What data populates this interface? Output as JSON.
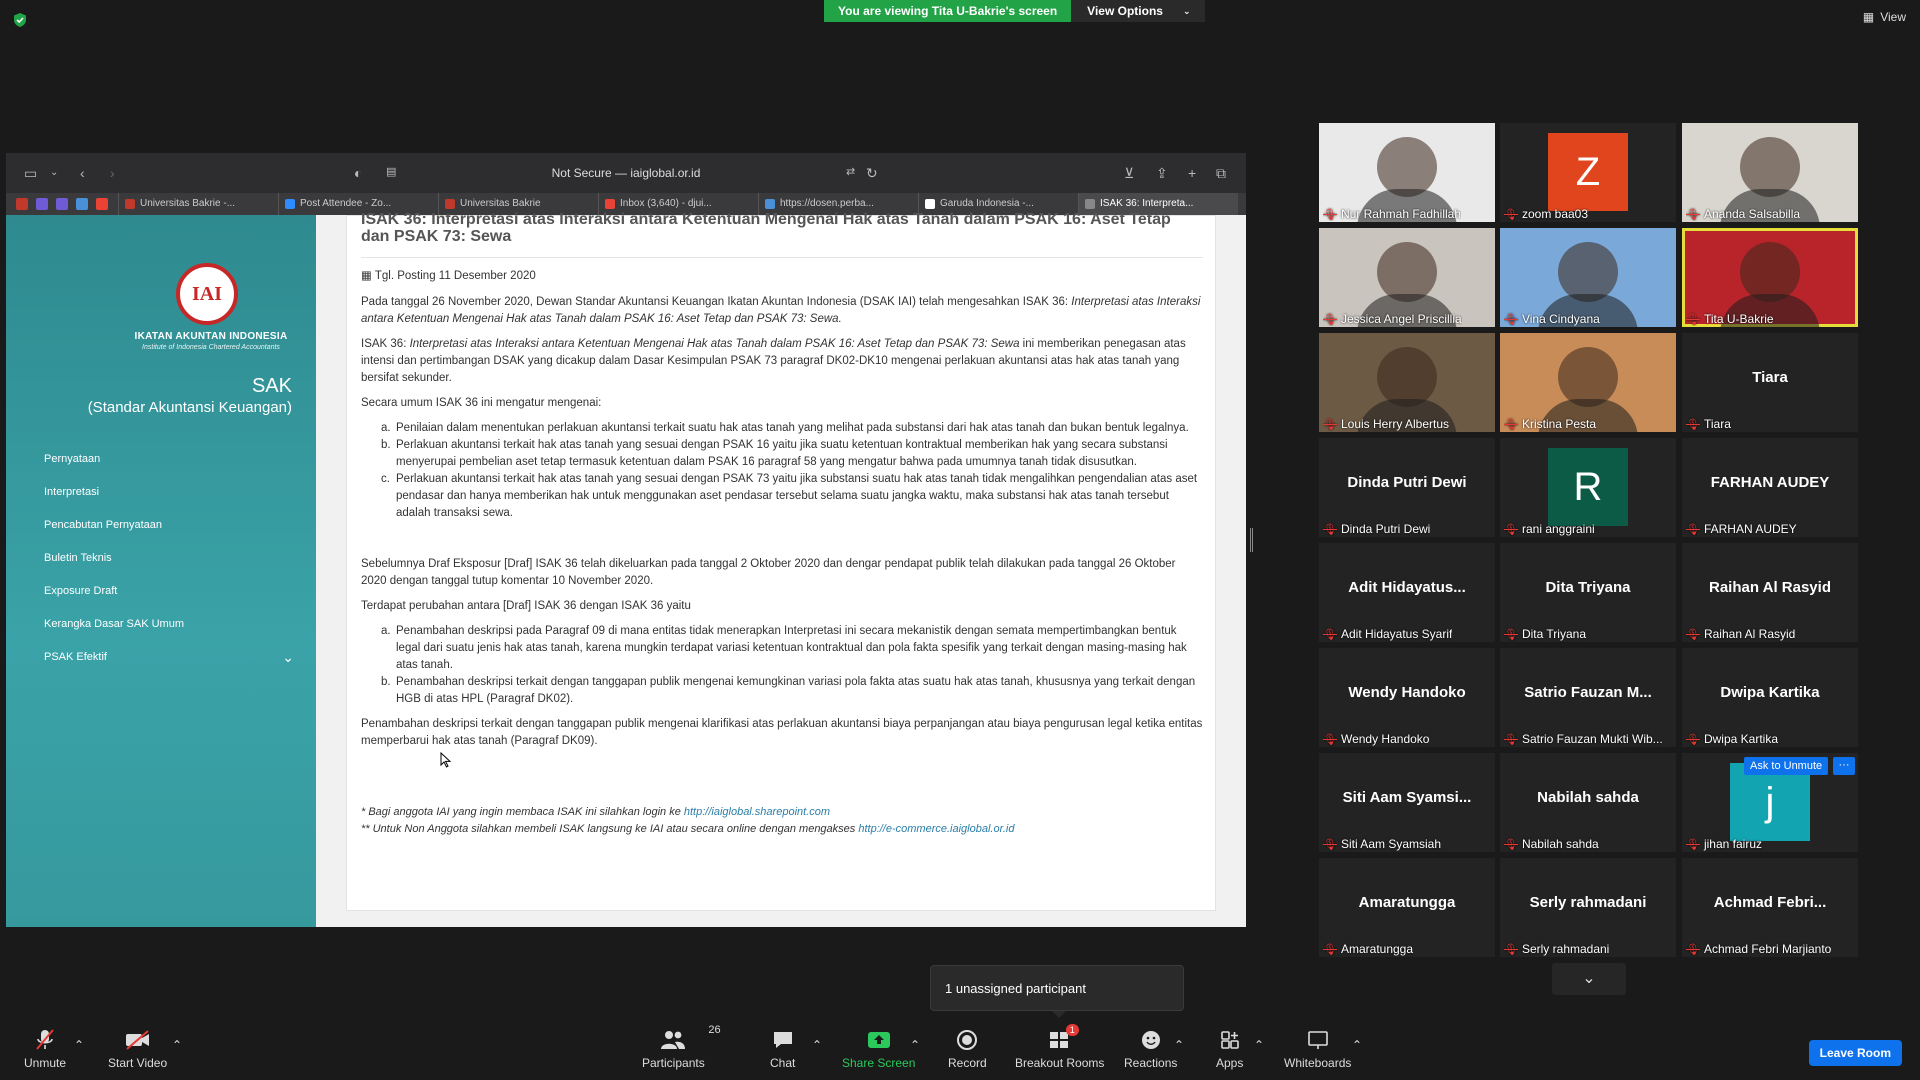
{
  "top": {
    "viewing_banner": "You are viewing Tita U-Bakrie's screen",
    "view_options": "View Options",
    "view": "View"
  },
  "browser": {
    "url": "Not Secure — iaiglobal.or.id",
    "tabs": [
      {
        "label": "Universitas Bakrie -...",
        "color": "#c0392b"
      },
      {
        "label": "Post Attendee - Zo...",
        "color": "#2d8cff"
      },
      {
        "label": "Universitas Bakrie",
        "color": "#c0392b"
      },
      {
        "label": "Inbox (3,640) - djui...",
        "color": "#ea4335"
      },
      {
        "label": "https://dosen.perba...",
        "color": "#4a90d9"
      },
      {
        "label": "Garuda Indonesia -...",
        "color": "#ffffff"
      },
      {
        "label": "ISAK 36: Interpreta...",
        "color": "#888888"
      }
    ]
  },
  "site": {
    "logo_text": "IKATAN AKUNTAN INDONESIA",
    "logo_sub": "Institute of Indonesia Chartered Accountants",
    "logo_mark": "IAI",
    "sak_title": "SAK",
    "sak_subtitle": "(Standar Akuntansi Keuangan)",
    "menu": [
      "Pernyataan",
      "Interpretasi",
      "Pencabutan Pernyataan",
      "Buletin Teknis",
      "Exposure Draft",
      "Kerangka Dasar SAK Umum",
      "PSAK Efektif"
    ]
  },
  "article": {
    "title": "ISAK 36: Interpretasi atas Interaksi antara Ketentuan Mengenai Hak atas Tanah dalam PSAK 16: Aset Tetap dan PSAK 73: Sewa",
    "date": "Tgl. Posting 11 Desember 2020",
    "p1_a": "Pada tanggal 26 November 2020, Dewan Standar Akuntansi Keuangan Ikatan Akuntan Indonesia (DSAK IAI) telah mengesahkan ISAK 36: ",
    "p1_b": "Interpretasi atas Interaksi antara Ketentuan Mengenai Hak atas Tanah dalam PSAK 16: Aset Tetap dan PSAK 73: Sewa.",
    "p2_a": "ISAK 36: ",
    "p2_b": "Interpretasi atas Interaksi antara Ketentuan Mengenai Hak atas Tanah dalam PSAK 16: Aset Tetap dan PSAK 73: Sewa",
    "p2_c": " ini memberikan penegasan atas intensi dan pertimbangan DSAK yang dicakup dalam Dasar Kesimpulan PSAK 73 paragraf DK02-DK10 mengenai perlakuan akuntansi atas hak atas tanah yang bersifat sekunder.",
    "p3": "Secara umum ISAK 36 ini mengatur mengenai:",
    "list1": [
      {
        "letter": "a.",
        "text": "Penilaian dalam menentukan perlakuan akuntansi terkait suatu hak atas tanah yang melihat pada substansi dari hak atas tanah dan bukan bentuk legalnya."
      },
      {
        "letter": "b.",
        "text": "Perlakuan akuntansi terkait hak atas tanah yang sesuai dengan PSAK 16 yaitu jika suatu ketentuan kontraktual memberikan hak yang secara substansi menyerupai pembelian aset tetap termasuk ketentuan dalam PSAK 16 paragraf 58 yang mengatur bahwa pada umumnya tanah tidak disusutkan."
      },
      {
        "letter": "c.",
        "text": "Perlakuan akuntansi terkait hak atas tanah yang sesuai dengan PSAK 73 yaitu jika substansi suatu hak atas tanah tidak mengalihkan pengendalian atas aset pendasar dan hanya memberikan hak untuk menggunakan aset pendasar tersebut selama suatu jangka waktu, maka substansi hak atas tanah tersebut adalah transaksi sewa."
      }
    ],
    "p4": "Sebelumnya Draf Eksposur [Draf] ISAK 36 telah dikeluarkan pada tanggal 2 Oktober 2020 dan dengar pendapat publik telah dilakukan pada tanggal 26 Oktober 2020 dengan tanggal tutup komentar 10 November 2020.",
    "p5": "Terdapat perubahan antara [Draf] ISAK 36 dengan ISAK 36 yaitu",
    "list2": [
      {
        "letter": "a.",
        "text": "Penambahan deskripsi pada Paragraf 09 di mana entitas tidak menerapkan Interpretasi ini secara mekanistik dengan semata mempertimbangkan bentuk legal dari suatu jenis hak atas tanah, karena mungkin terdapat variasi ketentuan kontraktual dan pola fakta spesifik yang terkait dengan masing-masing hak atas tanah."
      },
      {
        "letter": "b.",
        "text": "Penambahan deskripsi terkait dengan tanggapan publik mengenai kemungkinan variasi pola fakta atas suatu hak atas tanah, khususnya yang terkait dengan HGB di atas HPL (Paragraf DK02)."
      }
    ],
    "p6": "Penambahan deskripsi terkait dengan tanggapan publik mengenai klarifikasi atas perlakuan akuntansi biaya perpanjangan atau biaya pengurusan legal ketika entitas memperbarui hak atas tanah (Paragraf DK09).",
    "foot1_a": "* Bagi anggota IAI yang ingin membaca ISAK ini silahkan login ke ",
    "foot1_link": "http://iaiglobal.sharepoint.com",
    "foot2_a": "** Untuk Non Anggota silahkan membeli ISAK langsung ke IAI atau secara online dengan mengakses ",
    "foot2_link": "http://e-commerce.iaiglobal.or.id"
  },
  "participants": [
    {
      "name": "Nur Rahmah Fadhillah",
      "type": "video",
      "bg": "#e9e9e9"
    },
    {
      "name": "zoom baa03",
      "type": "avatar",
      "letter": "Z",
      "avatar_color": "#e0451d"
    },
    {
      "name": "Ananda Salsabilla",
      "type": "video",
      "bg": "#d8d6cf"
    },
    {
      "name": "Jessica Angel Priscillia",
      "type": "video",
      "bg": "#c9c4bd"
    },
    {
      "name": "Vina Cindyana",
      "type": "video",
      "bg": "#7aa8d8"
    },
    {
      "name": "Tita U-Bakrie",
      "type": "video",
      "bg": "#b8242a",
      "active": true
    },
    {
      "name": "Louis Herry Albertus",
      "type": "video",
      "bg": "#6d5a45"
    },
    {
      "name": "Kristina Pesta",
      "type": "video",
      "bg": "#c88c58"
    },
    {
      "name": "Tiara",
      "type": "name",
      "big": "Tiara"
    },
    {
      "name": "Dinda Putri Dewi",
      "type": "name",
      "big": "Dinda Putri Dewi"
    },
    {
      "name": "rani anggraini",
      "type": "avatar",
      "letter": "R",
      "avatar_color": "#0b5b46"
    },
    {
      "name": "FARHAN AUDEY",
      "type": "name",
      "big": "FARHAN AUDEY"
    },
    {
      "name": "Adit Hidayatus Syarif",
      "type": "name",
      "big": "Adit  Hidayatus..."
    },
    {
      "name": "Dita Triyana",
      "type": "name",
      "big": "Dita Triyana"
    },
    {
      "name": "Raihan Al Rasyid",
      "type": "name",
      "big": "Raihan Al Rasyid"
    },
    {
      "name": "Wendy Handoko",
      "type": "name",
      "big": "Wendy Handoko"
    },
    {
      "name": "Satrio Fauzan Mukti Wib...",
      "type": "name",
      "big": "Satrio  Fauzan  M..."
    },
    {
      "name": "Dwipa Kartika",
      "type": "name",
      "big": "Dwipa Kartika"
    },
    {
      "name": "Siti Aam Syamsiah",
      "type": "name",
      "big": "Siti  Aam  Syamsi..."
    },
    {
      "name": "Nabilah sahda",
      "type": "name",
      "big": "Nabilah sahda"
    },
    {
      "name": "jihan fairuz",
      "type": "avatar",
      "letter": "j",
      "avatar_color": "#12a4b0"
    },
    {
      "name": "Amaratungga",
      "type": "name",
      "big": "Amaratungga"
    },
    {
      "name": "Serly rahmadani",
      "type": "name",
      "big": "Serly rahmadani"
    },
    {
      "name": "Achmad Febri Marjianto",
      "type": "name",
      "big": "Achmad  Febri..."
    }
  ],
  "ask_to_unmute": "Ask to Unmute",
  "more": "···",
  "popup": "1 unassigned participant",
  "controls": {
    "unmute": "Unmute",
    "start_video": "Start Video",
    "participants": "Participants",
    "participants_count": "26",
    "chat": "Chat",
    "share_screen": "Share Screen",
    "record": "Record",
    "breakout_rooms": "Breakout Rooms",
    "breakout_badge": "1",
    "reactions": "Reactions",
    "apps": "Apps",
    "whiteboards": "Whiteboards",
    "leave_room": "Leave Room"
  }
}
